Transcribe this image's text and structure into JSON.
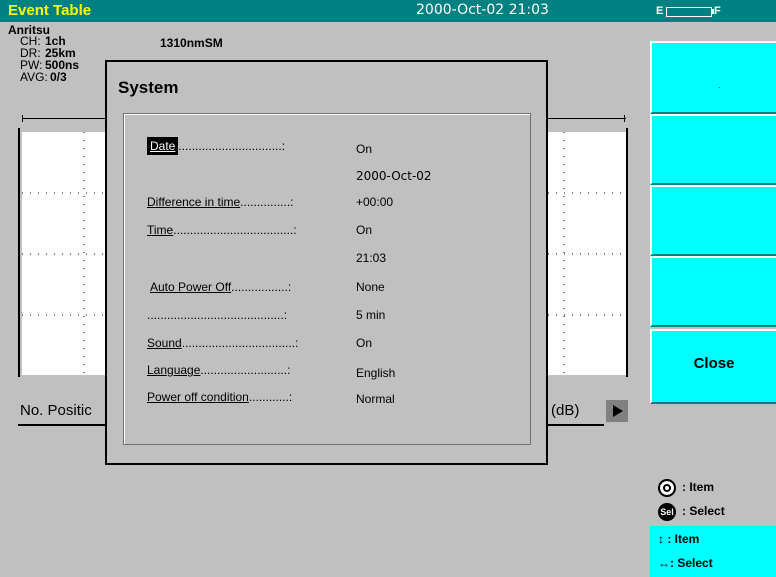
{
  "header": {
    "title": "Event Table",
    "datetime": "2000-Oct-02 21:03",
    "battery_empty_label": "E",
    "battery_full_label": "F"
  },
  "measurement": {
    "brand": "Anritsu",
    "rows": [
      {
        "key": "CH:",
        "value": "1ch"
      },
      {
        "key": "DR:",
        "value": "25km"
      },
      {
        "key": "PW:",
        "value": "500ns"
      },
      {
        "key": "AVG:",
        "value": "0/3"
      }
    ],
    "wavelength": "1310nmSM",
    "position_label": "No. Positic",
    "unit_label": "(dB)"
  },
  "softkeys": [
    {
      "label": ""
    },
    {
      "label": ""
    },
    {
      "label": ""
    },
    {
      "label": ""
    },
    {
      "label": "Close"
    }
  ],
  "legend": {
    "dial_item": "Item",
    "sel_select": "Select",
    "sel_icon_text": "Sel",
    "updown_item": "Item",
    "leftright_select": "Select"
  },
  "dialog": {
    "title": "System",
    "settings": [
      {
        "name": "Date",
        "dots": "...............................:",
        "value": "On"
      },
      {
        "name": "",
        "dots": "",
        "value": "2000-Oct-02"
      },
      {
        "name": "Difference in time",
        "dots": "...............:",
        "value": "+00:00"
      },
      {
        "name": "Time",
        "dots": "....................................:",
        "value": "On"
      },
      {
        "name": "",
        "dots": "",
        "value": "21:03"
      },
      {
        "name": "Auto Power Off",
        "dots": ".................:",
        "value": "None"
      },
      {
        "name": "",
        "dots": ".........................................:",
        "value": "5 min"
      },
      {
        "name": "Sound",
        "dots": "..................................:",
        "value": "On"
      },
      {
        "name": "Language",
        "dots": "..........................:",
        "value": "English"
      },
      {
        "name": "Power off condition",
        "dots": "............:",
        "value": "Normal"
      }
    ]
  }
}
